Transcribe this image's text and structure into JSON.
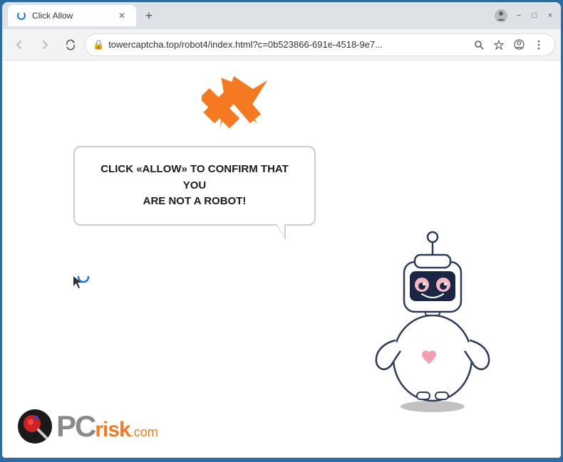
{
  "browser": {
    "title": "Click Allow",
    "tab_title": "Click Allow",
    "url": "towercaptcha.top/robot4/index.html?c=0b523866-691e-4518-9e7...",
    "new_tab_label": "+",
    "window_controls": {
      "minimize": "−",
      "maximize": "□",
      "close": "×"
    }
  },
  "toolbar": {
    "back_label": "←",
    "forward_label": "→",
    "reload_label": "×",
    "lock_icon": "🔒"
  },
  "page": {
    "bubble_text_line1": "CLICK «ALLOW» TO CONFIRM THAT YOU",
    "bubble_text_line2": "ARE NOT A ROBOT!",
    "bubble_text": "CLICK «ALLOW» TO CONFIRM THAT YOU ARE NOT A ROBOT!"
  },
  "logo": {
    "pc_text": "PC",
    "risk_text": "risk",
    "com_text": ".com"
  }
}
